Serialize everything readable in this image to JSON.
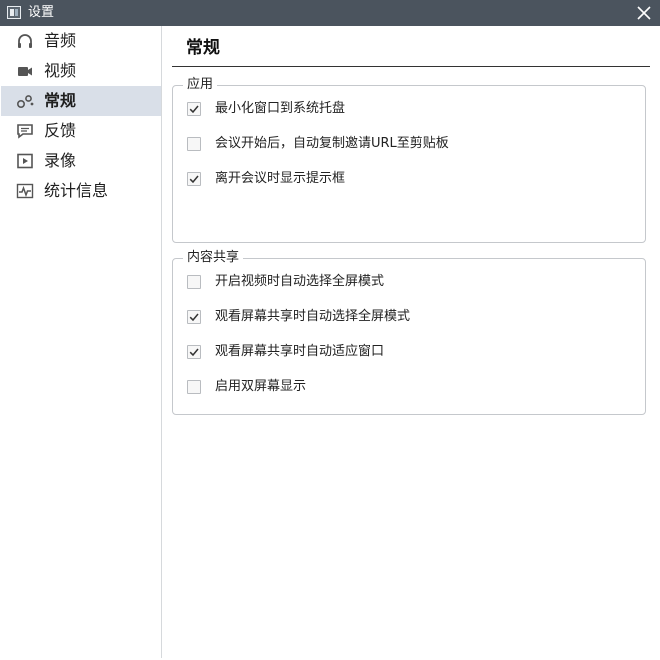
{
  "window": {
    "title": "设置"
  },
  "sidebar": {
    "items": [
      {
        "label": "音频",
        "icon": "headphones-icon",
        "active": false
      },
      {
        "label": "视频",
        "icon": "video-camera-icon",
        "active": false
      },
      {
        "label": "常规",
        "icon": "gears-icon",
        "active": true
      },
      {
        "label": "反馈",
        "icon": "chat-bubble-icon",
        "active": false
      },
      {
        "label": "录像",
        "icon": "play-icon",
        "active": false
      },
      {
        "label": "统计信息",
        "icon": "activity-pulse-icon",
        "active": false
      }
    ]
  },
  "main": {
    "title": "常规",
    "groups": [
      {
        "legend": "应用",
        "options": [
          {
            "label": "最小化窗口到系统托盘",
            "checked": true
          },
          {
            "label": "会议开始后，自动复制邀请URL至剪贴板",
            "checked": false
          },
          {
            "label": "离开会议时显示提示框",
            "checked": true
          }
        ]
      },
      {
        "legend": "内容共享",
        "options": [
          {
            "label": "开启视频时自动选择全屏模式",
            "checked": false
          },
          {
            "label": "观看屏幕共享时自动选择全屏模式",
            "checked": true
          },
          {
            "label": "观看屏幕共享时自动适应窗口",
            "checked": true
          },
          {
            "label": "启用双屏幕显示",
            "checked": false
          }
        ]
      }
    ]
  },
  "colors": {
    "titlebar": "#4b545e",
    "active_nav": "#d9dfe8",
    "border": "#c5c8cc"
  }
}
